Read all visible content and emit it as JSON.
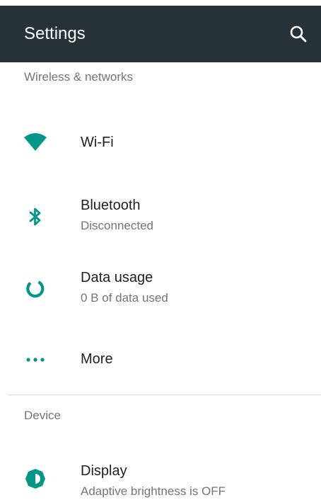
{
  "app_bar": {
    "title": "Settings",
    "search_icon": "search-icon"
  },
  "colors": {
    "app_bar_bg": "#263238",
    "accent": "#009688",
    "title_text": "#212121",
    "secondary_text": "#757575"
  },
  "sections": [
    {
      "header": "Wireless & networks",
      "items": [
        {
          "icon": "wifi-icon",
          "title": "Wi-Fi",
          "summary": ""
        },
        {
          "icon": "bluetooth-icon",
          "title": "Bluetooth",
          "summary": "Disconnected"
        },
        {
          "icon": "data-usage-icon",
          "title": "Data usage",
          "summary": "0 B of data used"
        },
        {
          "icon": "more-icon",
          "title": "More",
          "summary": ""
        }
      ]
    },
    {
      "header": "Device",
      "items": [
        {
          "icon": "display-icon",
          "title": "Display",
          "summary": "Adaptive brightness is OFF"
        }
      ]
    }
  ]
}
